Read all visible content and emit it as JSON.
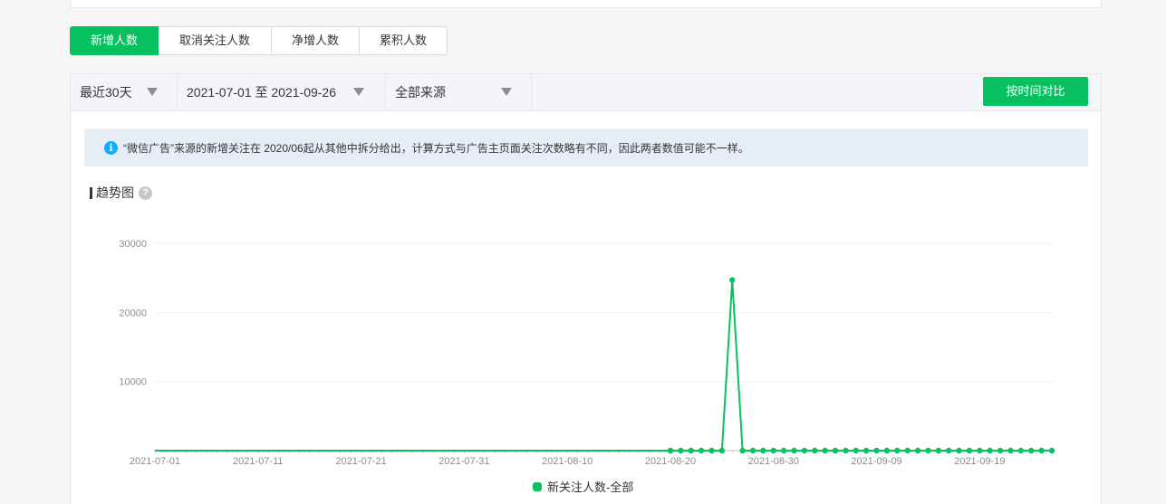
{
  "tabs": [
    {
      "label": "新增人数",
      "active": true
    },
    {
      "label": "取消关注人数",
      "active": false
    },
    {
      "label": "净增人数",
      "active": false
    },
    {
      "label": "累积人数",
      "active": false
    }
  ],
  "filters": {
    "range": "最近30天",
    "date": "2021-07-01 至 2021-09-26",
    "source": "全部来源"
  },
  "compare_button": "按时间对比",
  "notice": "“微信广告”来源的新增关注在 2020/06起从其他中拆分给出，计算方式与广告主页面关注次数略有不同，因此两者数值可能不一样。",
  "trend_title": "趋势图",
  "icons": {
    "info": "info-icon",
    "help": "help-icon",
    "dropdown": "triangle-down-icon"
  },
  "colors": {
    "accent": "#07c160",
    "notice_bg": "#e6edf7",
    "info": "#10aeff"
  },
  "chart_data": {
    "type": "line",
    "start_date": "2021-07-01",
    "x_tick_labels": [
      "2021-07-01",
      "2021-07-11",
      "2021-07-21",
      "2021-07-31",
      "2021-08-10",
      "2021-08-20",
      "2021-08-30",
      "2021-09-09",
      "2021-09-19"
    ],
    "y_tick_labels": [
      "10000",
      "20000",
      "30000"
    ],
    "ylim": [
      0,
      30000
    ],
    "grid": true,
    "legend_position": "bottom-center",
    "series": [
      {
        "name": "新关注人数-全部",
        "color": "#07c160",
        "first_marked_date": "2021-08-20",
        "values": [
          0,
          0,
          0,
          0,
          0,
          0,
          0,
          0,
          0,
          0,
          0,
          0,
          0,
          0,
          0,
          0,
          0,
          0,
          0,
          0,
          0,
          0,
          0,
          0,
          0,
          0,
          0,
          0,
          0,
          0,
          0,
          0,
          0,
          0,
          0,
          0,
          0,
          0,
          0,
          0,
          0,
          0,
          0,
          0,
          0,
          0,
          0,
          0,
          0,
          0,
          0,
          0,
          0,
          0,
          0,
          0,
          24700,
          0,
          0,
          0,
          0,
          0,
          0,
          0,
          0,
          0,
          0,
          0,
          0,
          0,
          0,
          0,
          0,
          0,
          0,
          0,
          0,
          0,
          0,
          0,
          0,
          0,
          0,
          0,
          0,
          0,
          0,
          0
        ]
      }
    ]
  }
}
